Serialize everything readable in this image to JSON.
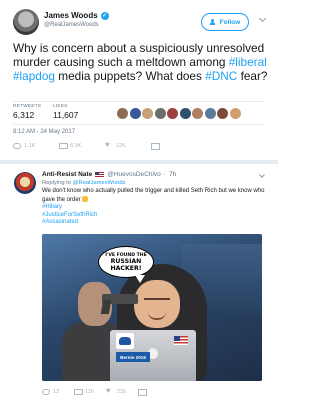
{
  "main_tweet": {
    "author_name": "James Woods",
    "author_handle": "@RealJamesWoods",
    "follow_label": "Follow",
    "text_parts": [
      {
        "t": "Why is concern about a suspiciously unresolved murder causing such a meltdown among ",
        "tag": false
      },
      {
        "t": "#liberal",
        "tag": true
      },
      {
        "t": " ",
        "tag": false
      },
      {
        "t": "#lapdog",
        "tag": true
      },
      {
        "t": " media puppets? What does ",
        "tag": false
      },
      {
        "t": "#DNC",
        "tag": true
      },
      {
        "t": " fear?",
        "tag": false
      }
    ],
    "retweets_label": "RETWEETS",
    "retweets_value": "6,312",
    "likes_label": "LIKES",
    "likes_value": "11,607",
    "timestamp": "8:12 AM - 24 May 2017",
    "reply_count": "1.1K",
    "retweet_count": "6.3K",
    "like_count": "12K",
    "face_colors": [
      "#8e6b55",
      "#3b5998",
      "#c9a27a",
      "#6d6d6d",
      "#a04040",
      "#2f4f6f",
      "#b08060",
      "#5c7a99",
      "#7a4a3a",
      "#d0a070"
    ]
  },
  "reply_tweet": {
    "author_name": "Anti-Resist Nate",
    "author_handle": "@HuevosDeChivo",
    "time": "7h",
    "replying_prefix": "Replying to",
    "replying_handle": "@RealJamesWoods",
    "body_line1": "We don't know who actually pulled the trigger and killed Seth Rich but we know who gave the order",
    "hashtags": [
      "#Hillary",
      "#JusticeForSethRich",
      "#Assasinated"
    ],
    "meme_bubble_line1": "I'VE FOUND THE",
    "meme_bubble_line2": "RUSSIAN",
    "meme_bubble_line3": "HACKER!",
    "meme_sticker": "Bernie 2016",
    "reply_count": "13",
    "retweet_count": "116",
    "like_count": "235"
  },
  "colors": {
    "accent": "#1da1f2",
    "muted": "#657786",
    "divider": "#e6ecf0"
  }
}
